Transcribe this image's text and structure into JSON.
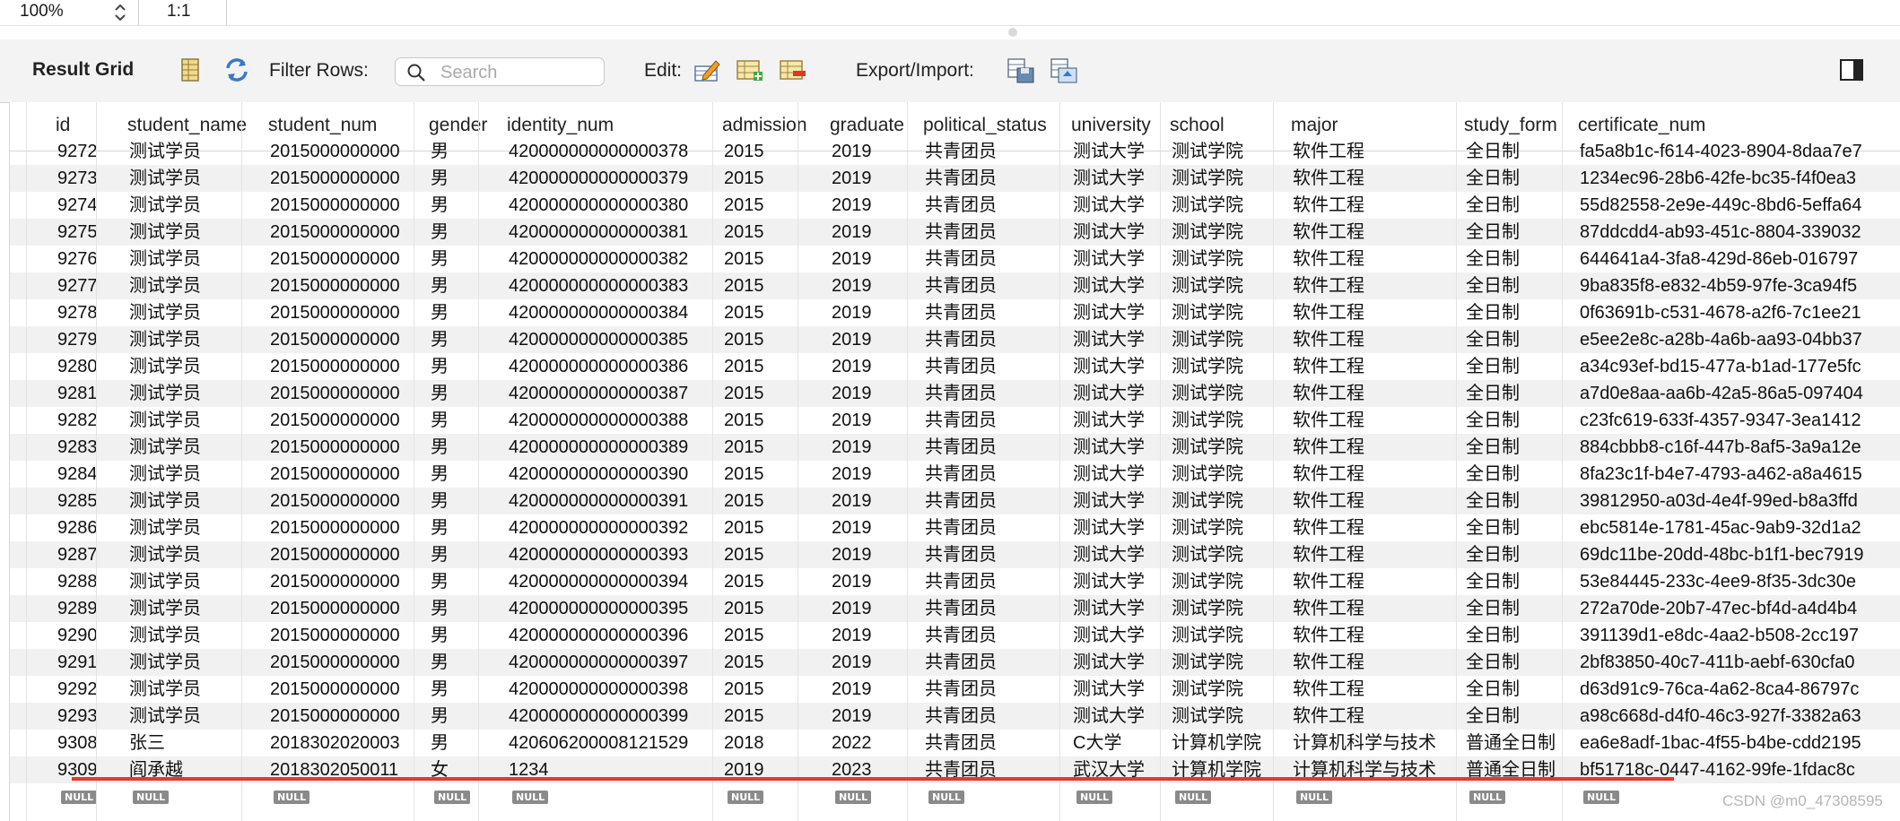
{
  "topbar": {
    "zoom": "100%",
    "ratio": "1:1"
  },
  "toolbar": {
    "result_grid_label": "Result Grid",
    "filter_label": "Filter Rows:",
    "search_placeholder": "Search",
    "edit_label": "Edit:",
    "export_label": "Export/Import:"
  },
  "columns": [
    "id",
    "student_name",
    "student_num",
    "gender",
    "identity_num",
    "admission",
    "graduate",
    "political_status",
    "university",
    "school",
    "major",
    "study_form",
    "certificate_num"
  ],
  "partial_row": [
    "9272",
    "测试学员",
    "2015000000000",
    "男",
    "420000000000000378",
    "2015",
    "2019",
    "共青团员",
    "测试大学",
    "测试学院",
    "软件工程",
    "全日制",
    "fa5a8b1c-f614-4023-8904-8daa7e7"
  ],
  "rows": [
    [
      "9273",
      "测试学员",
      "2015000000000",
      "男",
      "420000000000000379",
      "2015",
      "2019",
      "共青团员",
      "测试大学",
      "测试学院",
      "软件工程",
      "全日制",
      "1234ec96-28b6-42fe-bc35-f4f0ea3"
    ],
    [
      "9274",
      "测试学员",
      "2015000000000",
      "男",
      "420000000000000380",
      "2015",
      "2019",
      "共青团员",
      "测试大学",
      "测试学院",
      "软件工程",
      "全日制",
      "55d82558-2e9e-449c-8bd6-5effa64"
    ],
    [
      "9275",
      "测试学员",
      "2015000000000",
      "男",
      "420000000000000381",
      "2015",
      "2019",
      "共青团员",
      "测试大学",
      "测试学院",
      "软件工程",
      "全日制",
      "87ddcdd4-ab93-451c-8804-339032"
    ],
    [
      "9276",
      "测试学员",
      "2015000000000",
      "男",
      "420000000000000382",
      "2015",
      "2019",
      "共青团员",
      "测试大学",
      "测试学院",
      "软件工程",
      "全日制",
      "644641a4-3fa8-429d-86eb-016797"
    ],
    [
      "9277",
      "测试学员",
      "2015000000000",
      "男",
      "420000000000000383",
      "2015",
      "2019",
      "共青团员",
      "测试大学",
      "测试学院",
      "软件工程",
      "全日制",
      "9ba835f8-e832-4b59-97fe-3ca94f5"
    ],
    [
      "9278",
      "测试学员",
      "2015000000000",
      "男",
      "420000000000000384",
      "2015",
      "2019",
      "共青团员",
      "测试大学",
      "测试学院",
      "软件工程",
      "全日制",
      "0f63691b-c531-4678-a2f6-7c1ee21"
    ],
    [
      "9279",
      "测试学员",
      "2015000000000",
      "男",
      "420000000000000385",
      "2015",
      "2019",
      "共青团员",
      "测试大学",
      "测试学院",
      "软件工程",
      "全日制",
      "e5ee2e8c-a28b-4a6b-aa93-04bb37"
    ],
    [
      "9280",
      "测试学员",
      "2015000000000",
      "男",
      "420000000000000386",
      "2015",
      "2019",
      "共青团员",
      "测试大学",
      "测试学院",
      "软件工程",
      "全日制",
      "a34c93ef-bd15-477a-b1ad-177e5fc"
    ],
    [
      "9281",
      "测试学员",
      "2015000000000",
      "男",
      "420000000000000387",
      "2015",
      "2019",
      "共青团员",
      "测试大学",
      "测试学院",
      "软件工程",
      "全日制",
      "a7d0e8aa-aa6b-42a5-86a5-097404"
    ],
    [
      "9282",
      "测试学员",
      "2015000000000",
      "男",
      "420000000000000388",
      "2015",
      "2019",
      "共青团员",
      "测试大学",
      "测试学院",
      "软件工程",
      "全日制",
      "c23fc619-633f-4357-9347-3ea1412"
    ],
    [
      "9283",
      "测试学员",
      "2015000000000",
      "男",
      "420000000000000389",
      "2015",
      "2019",
      "共青团员",
      "测试大学",
      "测试学院",
      "软件工程",
      "全日制",
      "884cbbb8-c16f-447b-8af5-3a9a12e"
    ],
    [
      "9284",
      "测试学员",
      "2015000000000",
      "男",
      "420000000000000390",
      "2015",
      "2019",
      "共青团员",
      "测试大学",
      "测试学院",
      "软件工程",
      "全日制",
      "8fa23c1f-b4e7-4793-a462-a8a4615"
    ],
    [
      "9285",
      "测试学员",
      "2015000000000",
      "男",
      "420000000000000391",
      "2015",
      "2019",
      "共青团员",
      "测试大学",
      "测试学院",
      "软件工程",
      "全日制",
      "39812950-a03d-4e4f-99ed-b8a3ffd"
    ],
    [
      "9286",
      "测试学员",
      "2015000000000",
      "男",
      "420000000000000392",
      "2015",
      "2019",
      "共青团员",
      "测试大学",
      "测试学院",
      "软件工程",
      "全日制",
      "ebc5814e-1781-45ac-9ab9-32d1a2"
    ],
    [
      "9287",
      "测试学员",
      "2015000000000",
      "男",
      "420000000000000393",
      "2015",
      "2019",
      "共青团员",
      "测试大学",
      "测试学院",
      "软件工程",
      "全日制",
      "69dc11be-20dd-48bc-b1f1-bec7919"
    ],
    [
      "9288",
      "测试学员",
      "2015000000000",
      "男",
      "420000000000000394",
      "2015",
      "2019",
      "共青团员",
      "测试大学",
      "测试学院",
      "软件工程",
      "全日制",
      "53e84445-233c-4ee9-8f35-3dc30e"
    ],
    [
      "9289",
      "测试学员",
      "2015000000000",
      "男",
      "420000000000000395",
      "2015",
      "2019",
      "共青团员",
      "测试大学",
      "测试学院",
      "软件工程",
      "全日制",
      "272a70de-20b7-47ec-bf4d-a4d4b4"
    ],
    [
      "9290",
      "测试学员",
      "2015000000000",
      "男",
      "420000000000000396",
      "2015",
      "2019",
      "共青团员",
      "测试大学",
      "测试学院",
      "软件工程",
      "全日制",
      "391139d1-e8dc-4aa2-b508-2cc197"
    ],
    [
      "9291",
      "测试学员",
      "2015000000000",
      "男",
      "420000000000000397",
      "2015",
      "2019",
      "共青团员",
      "测试大学",
      "测试学院",
      "软件工程",
      "全日制",
      "2bf83850-40c7-411b-aebf-630cfa0"
    ],
    [
      "9292",
      "测试学员",
      "2015000000000",
      "男",
      "420000000000000398",
      "2015",
      "2019",
      "共青团员",
      "测试大学",
      "测试学院",
      "软件工程",
      "全日制",
      "d63d91c9-76ca-4a62-8ca4-86797c"
    ],
    [
      "9293",
      "测试学员",
      "2015000000000",
      "男",
      "420000000000000399",
      "2015",
      "2019",
      "共青团员",
      "测试大学",
      "测试学院",
      "软件工程",
      "全日制",
      "a98c668d-d4f0-46c3-927f-3382a63"
    ],
    [
      "9308",
      "张三",
      "2018302020003",
      "男",
      "420606200008121529",
      "2018",
      "2022",
      "共青团员",
      "C大学",
      "计算机学院",
      "计算机科学与技术",
      "普通全日制",
      "ea6e8adf-1bac-4f55-b4be-cdd2195"
    ],
    [
      "9309",
      "阎承越",
      "2018302050011",
      "女",
      "1234",
      "2019",
      "2023",
      "共青团员",
      "武汉大学",
      "计算机学院",
      "计算机科学与技术",
      "普通全日制",
      "bf51718c-0447-4162-99fe-1fdac8c"
    ]
  ],
  "null_label": "NULL",
  "watermark": "CSDN @m0_47308595",
  "colors": {
    "accent_underline": "#e23a2a",
    "alt_row": "#f1f1f1"
  }
}
